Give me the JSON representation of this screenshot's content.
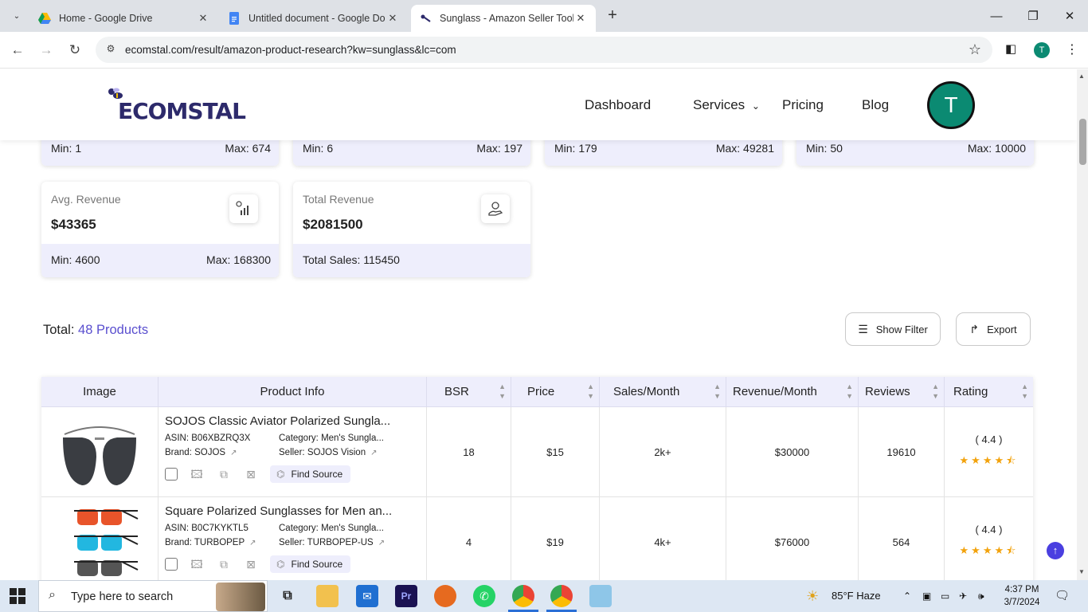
{
  "browser": {
    "tabs": [
      {
        "label": "Home - Google Drive",
        "icon": "google-drive-icon"
      },
      {
        "label": "Untitled document - Google Do",
        "icon": "google-docs-icon"
      },
      {
        "label": "Sunglass - Amazon Seller Tool l",
        "icon": "ecomstal-icon"
      }
    ],
    "url": "ecomstal.com/result/amazon-product-research?kw=sunglass&lc=com",
    "profile_initial": "T"
  },
  "site": {
    "logo_text": "ECOMSTAL",
    "nav": [
      "Dashboard",
      "Services",
      "Pricing",
      "Blog"
    ],
    "avatar_initial": "T"
  },
  "top_cards": [
    {
      "min": "Min: 1",
      "max": "Max: 674"
    },
    {
      "min": "Min: 6",
      "max": "Max: 197"
    },
    {
      "min": "Min: 179",
      "max": "Max: 49281"
    },
    {
      "min": "Min: 50",
      "max": "Max: 10000"
    }
  ],
  "cards": [
    {
      "title": "Avg. Revenue",
      "value": "$43365",
      "foot_left": "Min: 4600",
      "foot_right": "Max: 168300",
      "icon": "revenue-chart-icon"
    },
    {
      "title": "Total Revenue",
      "value": "$2081500",
      "foot_left": "Total Sales: 115450",
      "foot_right": "",
      "icon": "money-hand-icon"
    }
  ],
  "summary": {
    "label": "Total:",
    "count": "48 Products"
  },
  "buttons": {
    "filter": "Show Filter",
    "export": "Export"
  },
  "table": {
    "headers": [
      "Image",
      "Product Info",
      "BSR",
      "Price",
      "Sales/Month",
      "Revenue/Month",
      "Reviews",
      "Rating"
    ],
    "rows": [
      {
        "name": "SOJOS Classic Aviator Polarized Sungla...",
        "asin_label": "ASIN:",
        "asin": "B06XBZRQ3X",
        "brand_label": "Brand:",
        "brand": "SOJOS",
        "category_label": "Category:",
        "category": "Men's Sungla...",
        "seller_label": "Seller:",
        "seller": "SOJOS Vision",
        "find": "Find Source",
        "bsr": "18",
        "price": "$15",
        "sales": "2k+",
        "revenue": "$30000",
        "reviews": "19610",
        "rating": "( 4.4 )",
        "stars": "★★★★⯪"
      },
      {
        "name": "Square Polarized Sunglasses for Men an...",
        "asin_label": "ASIN:",
        "asin": "B0C7KYKTL5",
        "brand_label": "Brand:",
        "brand": "TURBOPEP",
        "category_label": "Category:",
        "category": "Men's Sungla...",
        "seller_label": "Seller:",
        "seller": "TURBOPEP-US",
        "find": "Find Source",
        "bsr": "4",
        "price": "$19",
        "sales": "4k+",
        "revenue": "$76000",
        "reviews": "564",
        "rating": "( 4.4 )",
        "stars": "★★★★⯪"
      }
    ]
  },
  "taskbar": {
    "search_placeholder": "Type here to search",
    "weather": "85°F  Haze",
    "time": "4:37 PM",
    "date": "3/7/2024"
  }
}
